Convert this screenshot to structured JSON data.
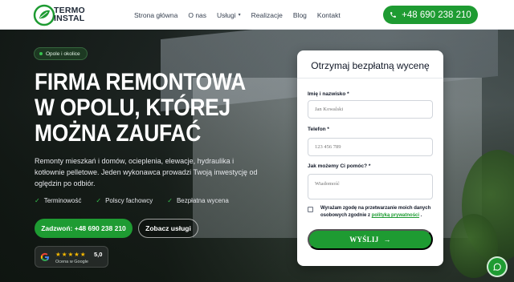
{
  "brand": {
    "line1": "TERMO",
    "line2": "INSTAL"
  },
  "nav": {
    "items": [
      {
        "label": "Strona główna"
      },
      {
        "label": "O nas"
      },
      {
        "label": "Usługi"
      },
      {
        "label": "Realizacje"
      },
      {
        "label": "Blog"
      },
      {
        "label": "Kontakt"
      }
    ],
    "phone": "+48 690 238 210"
  },
  "hero": {
    "badge": "Opole i okolice",
    "title": "Firma remontowa w Opolu, której można zaufać",
    "lead": "Remonty mieszkań i domów, ocieplenia, elewacje, hydraulika i kotłownie pelletowe. Jeden wykonawca prowadzi Twoją inwestycję od oględzin po odbiór.",
    "features": [
      "Terminowość",
      "Polscy fachowcy",
      "Bezpłatna wycena"
    ],
    "cta_primary": "Zadzwoń: +48 690 238 210",
    "cta_secondary": "Zobacz usługi",
    "google": {
      "stars": "★★★★★",
      "rating": "5,0",
      "label": "Ocena w Google"
    }
  },
  "form": {
    "title": "Otrzymaj bezpłatną wycenę",
    "name_label": "Imię i nazwisko *",
    "name_placeholder": "Jan Kowalski",
    "phone_label": "Telefon *",
    "phone_placeholder": "123 456 789",
    "help_label": "Jak możemy Ci pomóc? *",
    "help_placeholder": "Wiadomość",
    "consent_text": "Wyrażam zgodę na przetwarzanie moich danych osobowych zgodnie z",
    "consent_link": "polityką prywatności",
    "consent_end": ".",
    "submit": "WYŚLIJ"
  },
  "colors": {
    "accent": "#1e9b32",
    "star": "#f5b800"
  }
}
